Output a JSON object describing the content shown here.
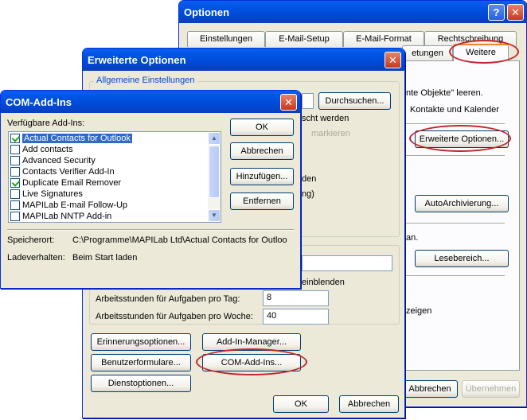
{
  "optionen": {
    "title": "Optionen",
    "tabs_row1": [
      "Einstellungen",
      "E-Mail-Setup",
      "E-Mail-Format",
      "Rechtschreibung"
    ],
    "tab_row2_partial": "etungen",
    "tab_selected": "Weitere",
    "text1": "nte Objekte\" leeren.",
    "text2": "Kontakte und Kalender",
    "erweiterte_btn": "Erweiterte Optionen...",
    "auto_btn": "AutoArchivierung...",
    "text3": "an.",
    "lesebereich_btn": "Lesebereich...",
    "text4": "zeigen",
    "abbrechen": "Abbrechen",
    "uebernehmen": "Übernehmen"
  },
  "erweiterte": {
    "title": "Erweiterte Optionen",
    "group1": "Allgemeine Einstellungen",
    "durchsuchen": "Durchsuchen...",
    "t_werden": "scht werden",
    "t_markieren": "markieren",
    "t_den": "den",
    "t_ng": "ng)",
    "t_einblenden": "einblenden",
    "tag_label": "Arbeitsstunden für Aufgaben pro Tag:",
    "tag_value": "8",
    "woche_label": "Arbeitsstunden für Aufgaben pro Woche:",
    "woche_value": "40",
    "erinnerung": "Erinnerungsoptionen...",
    "addin_mgr": "Add-In-Manager...",
    "benutzer": "Benutzerformulare...",
    "com_btn": "COM-Add-Ins...",
    "dienst": "Dienstoptionen...",
    "ok": "OK",
    "abbrechen": "Abbrechen"
  },
  "com": {
    "title": "COM-Add-Ins",
    "list_label": "Verfügbare Add-Ins:",
    "items": [
      {
        "name": "Actual Contacts for Outlook",
        "checked": true,
        "selected": true
      },
      {
        "name": "Add contacts",
        "checked": false,
        "selected": false
      },
      {
        "name": "Advanced Security",
        "checked": false,
        "selected": false
      },
      {
        "name": "Contacts Verifier Add-In",
        "checked": false,
        "selected": false
      },
      {
        "name": "Duplicate Email Remover",
        "checked": true,
        "selected": false
      },
      {
        "name": "Live Signatures",
        "checked": false,
        "selected": false
      },
      {
        "name": "MAPILab E-mail Follow-Up",
        "checked": false,
        "selected": false
      },
      {
        "name": "MAPILab NNTP Add-in",
        "checked": false,
        "selected": false
      }
    ],
    "ok": "OK",
    "abbrechen": "Abbrechen",
    "hinzufuegen": "Hinzufügen...",
    "entfernen": "Entfernen",
    "speicherort_label": "Speicherort:",
    "speicherort_value": "C:\\Programme\\MAPILab Ltd\\Actual Contacts for Outloo",
    "ladeverhalten_label": "Ladeverhalten:",
    "ladeverhalten_value": "Beim Start laden"
  },
  "colors": {
    "highlight_oval": "#c0262c",
    "title_bar": "#0054e3",
    "selection": "#316ac5"
  }
}
